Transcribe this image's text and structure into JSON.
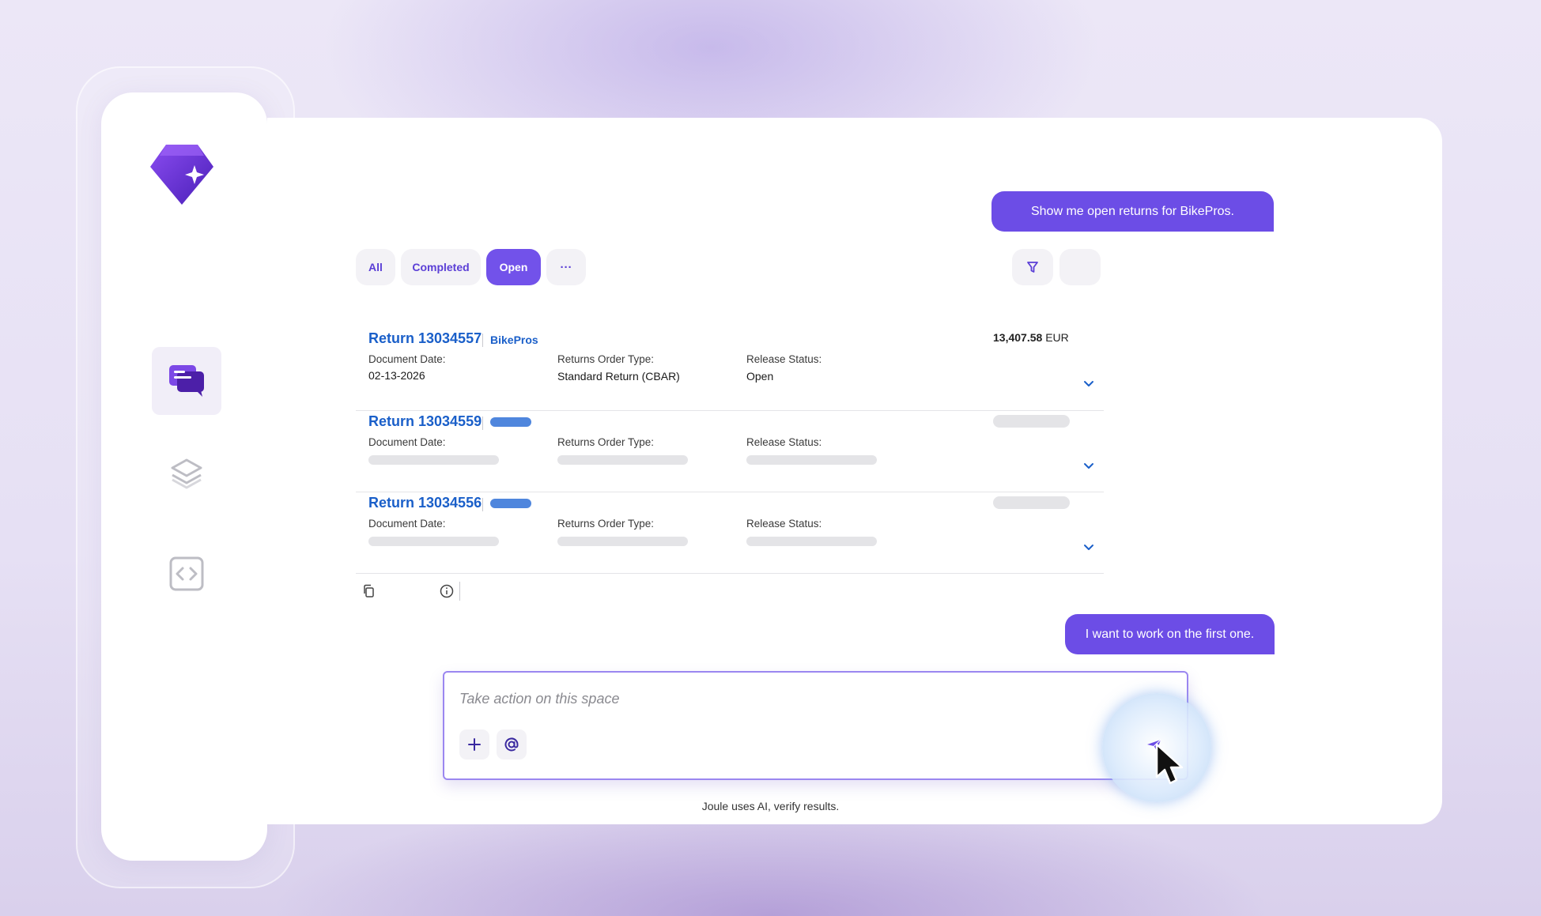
{
  "colors": {
    "accent": "#6c4de6",
    "link": "#1a5fc9",
    "skeleton": "#e4e4e7"
  },
  "sidebar": {
    "logo_icon": "joule-diamond-logo",
    "items": [
      {
        "name": "chat",
        "icon": "chat-bubbles-icon",
        "active": true
      },
      {
        "name": "layers",
        "icon": "layers-icon",
        "active": false
      },
      {
        "name": "code",
        "icon": "code-brackets-icon",
        "active": false
      }
    ]
  },
  "chat": {
    "user_message_1": "Show me open returns for BikePros.",
    "user_message_2": "I want to work on the first one."
  },
  "tabs": [
    {
      "label": "All",
      "active": false
    },
    {
      "label": "Completed",
      "active": false
    },
    {
      "label": "Open",
      "active": true
    },
    {
      "label": "···",
      "active": false
    }
  ],
  "labels": {
    "document_date": "Document Date:",
    "returns_order_type": "Returns Order Type:",
    "release_status": "Release Status:"
  },
  "returns": [
    {
      "title": "Return 13034557",
      "customer": "BikePros",
      "document_date": "02-13-2026",
      "returns_order_type": "Standard Return (CBAR)",
      "release_status": "Open",
      "amount": "13,407.58",
      "currency": "EUR",
      "loading": false
    },
    {
      "title": "Return 13034559",
      "loading": true
    },
    {
      "title": "Return 13034556",
      "loading": true
    }
  ],
  "composer": {
    "placeholder": "Take action on this space"
  },
  "footer": {
    "disclaimer": "Joule uses AI, verify results."
  }
}
